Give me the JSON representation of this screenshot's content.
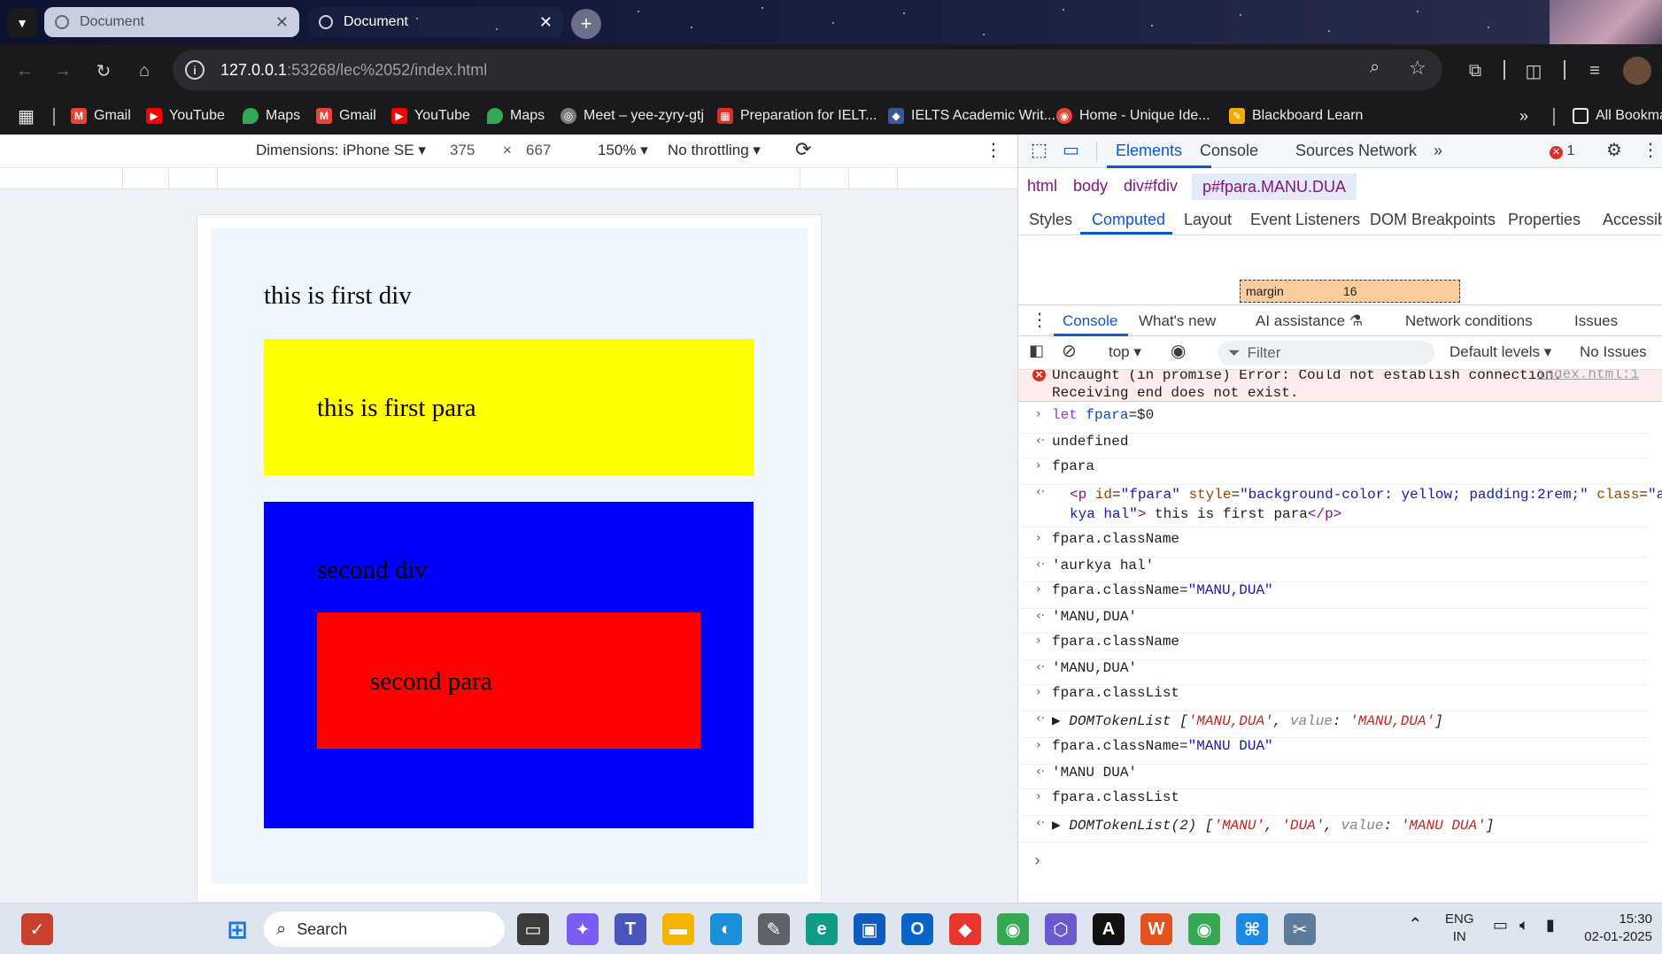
{
  "browser": {
    "tabs": [
      {
        "title": "Document",
        "active": false
      },
      {
        "title": "Document",
        "active": true
      }
    ],
    "url_host": "127.0.0.1",
    "url_rest": ":53268/lec%2052/index.html",
    "bookmarks": [
      {
        "label": "Gmail",
        "icon": "gmail-icon",
        "color": "#ea4335"
      },
      {
        "label": "YouTube",
        "icon": "youtube-icon",
        "color": "#ff0000"
      },
      {
        "label": "Maps",
        "icon": "maps-icon",
        "color": "#34a853"
      },
      {
        "label": "Gmail",
        "icon": "gmail-icon",
        "color": "#ea4335"
      },
      {
        "label": "YouTube",
        "icon": "youtube-icon",
        "color": "#ff0000"
      },
      {
        "label": "Maps",
        "icon": "maps-icon",
        "color": "#34a853"
      },
      {
        "label": "Meet – yee-zyry-gtj",
        "icon": "globe-icon",
        "color": "#9aa0a6"
      },
      {
        "label": "Preparation for IELT...",
        "icon": "grid-icon",
        "color": "#d93025"
      },
      {
        "label": "IELTS Academic Writ...",
        "icon": "shield-icon",
        "color": "#1a73e8"
      },
      {
        "label": "Home - Unique Ide...",
        "icon": "rss-icon",
        "color": "#ea4335"
      },
      {
        "label": "Blackboard Learn",
        "icon": "blackboard-icon",
        "color": "#f2a900"
      }
    ],
    "all_bookmarks": "All Bookma"
  },
  "device_toolbar": {
    "dimensions": "Dimensions: iPhone SE",
    "width": "375",
    "times": "×",
    "height": "667",
    "zoom": "150%",
    "throttling": "No throttling"
  },
  "page": {
    "first_div": "this is first div",
    "first_para": "this is first para",
    "second_div": "second div",
    "second_para": "second para",
    "colors": {
      "first_para": "#ffff00",
      "second_div": "#0000ff",
      "second_para": "#ff0000",
      "first_div": "#f0f7fc"
    }
  },
  "devtools": {
    "tabs": [
      "Elements",
      "Console",
      "Sources",
      "Network"
    ],
    "active_tab": "Elements",
    "error_count": "1",
    "breadcrumbs": [
      "html",
      "body",
      "div#fdiv",
      "p#fpara.MANU.DUA"
    ],
    "subtabs": [
      "Styles",
      "Computed",
      "Layout",
      "Event Listeners",
      "DOM Breakpoints",
      "Properties",
      "Accessibili"
    ],
    "active_subtab": "Computed",
    "margin_label": "margin",
    "margin_value": "16",
    "drawer_tabs": [
      "Console",
      "What's new",
      "AI assistance",
      "Network conditions",
      "Issues"
    ],
    "console_context": "top",
    "filter_placeholder": "Filter",
    "default_levels": "Default levels",
    "issues": "No Issues",
    "error_line1": "Uncaught (in promise) Error: Could not establish connection.",
    "error_line2": "Receiving end does not exist.",
    "error_source": "index.html:1"
  },
  "taskbar": {
    "search": "Search",
    "lang1": "ENG",
    "lang2": "IN",
    "time": "15:30",
    "date": "02-01-2025"
  }
}
